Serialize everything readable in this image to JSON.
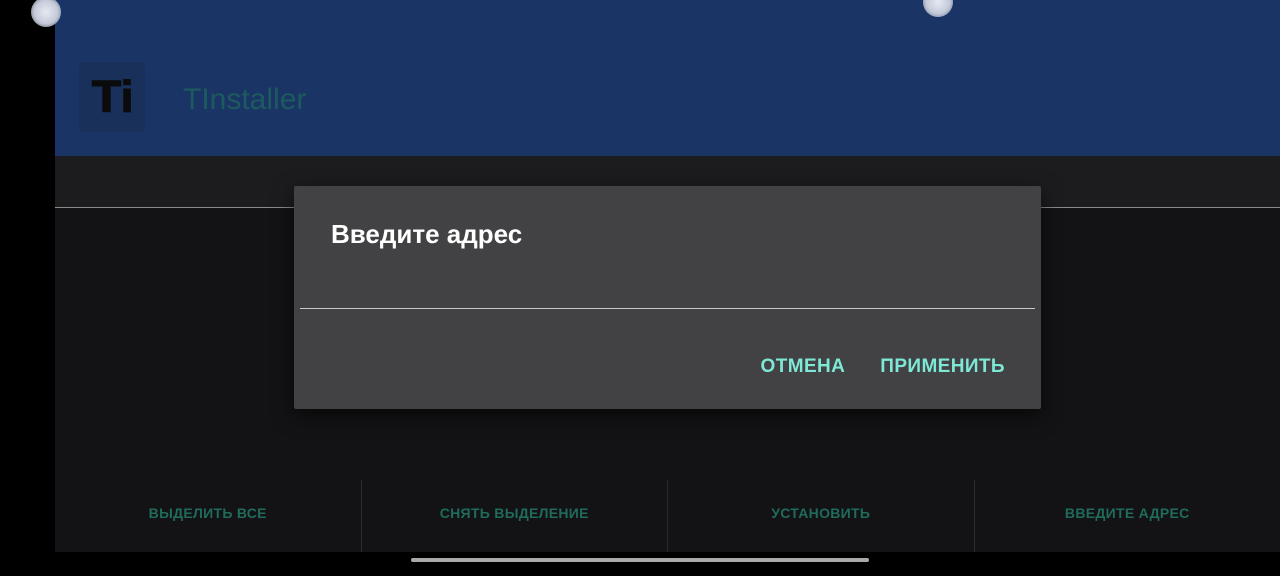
{
  "app": {
    "logo_text": "Ti",
    "title": "TInstaller"
  },
  "dialog": {
    "title": "Введите адрес",
    "input_value": "",
    "cancel_label": "ОТМЕНА",
    "apply_label": "ПРИМЕНИТЬ"
  },
  "bottom_bar": {
    "select_all": "ВЫДЕЛИТЬ ВСЕ",
    "deselect": "СНЯТЬ ВЫДЕЛЕНИЕ",
    "install": "УСТАНОВИТЬ",
    "enter_address": "ВВЕДИТЕ АДРЕС"
  },
  "colors": {
    "appbar": "#1a3565",
    "dialog_bg": "#424143",
    "accent": "#7ee8d6",
    "bottom_text": "#1f6b5c"
  }
}
